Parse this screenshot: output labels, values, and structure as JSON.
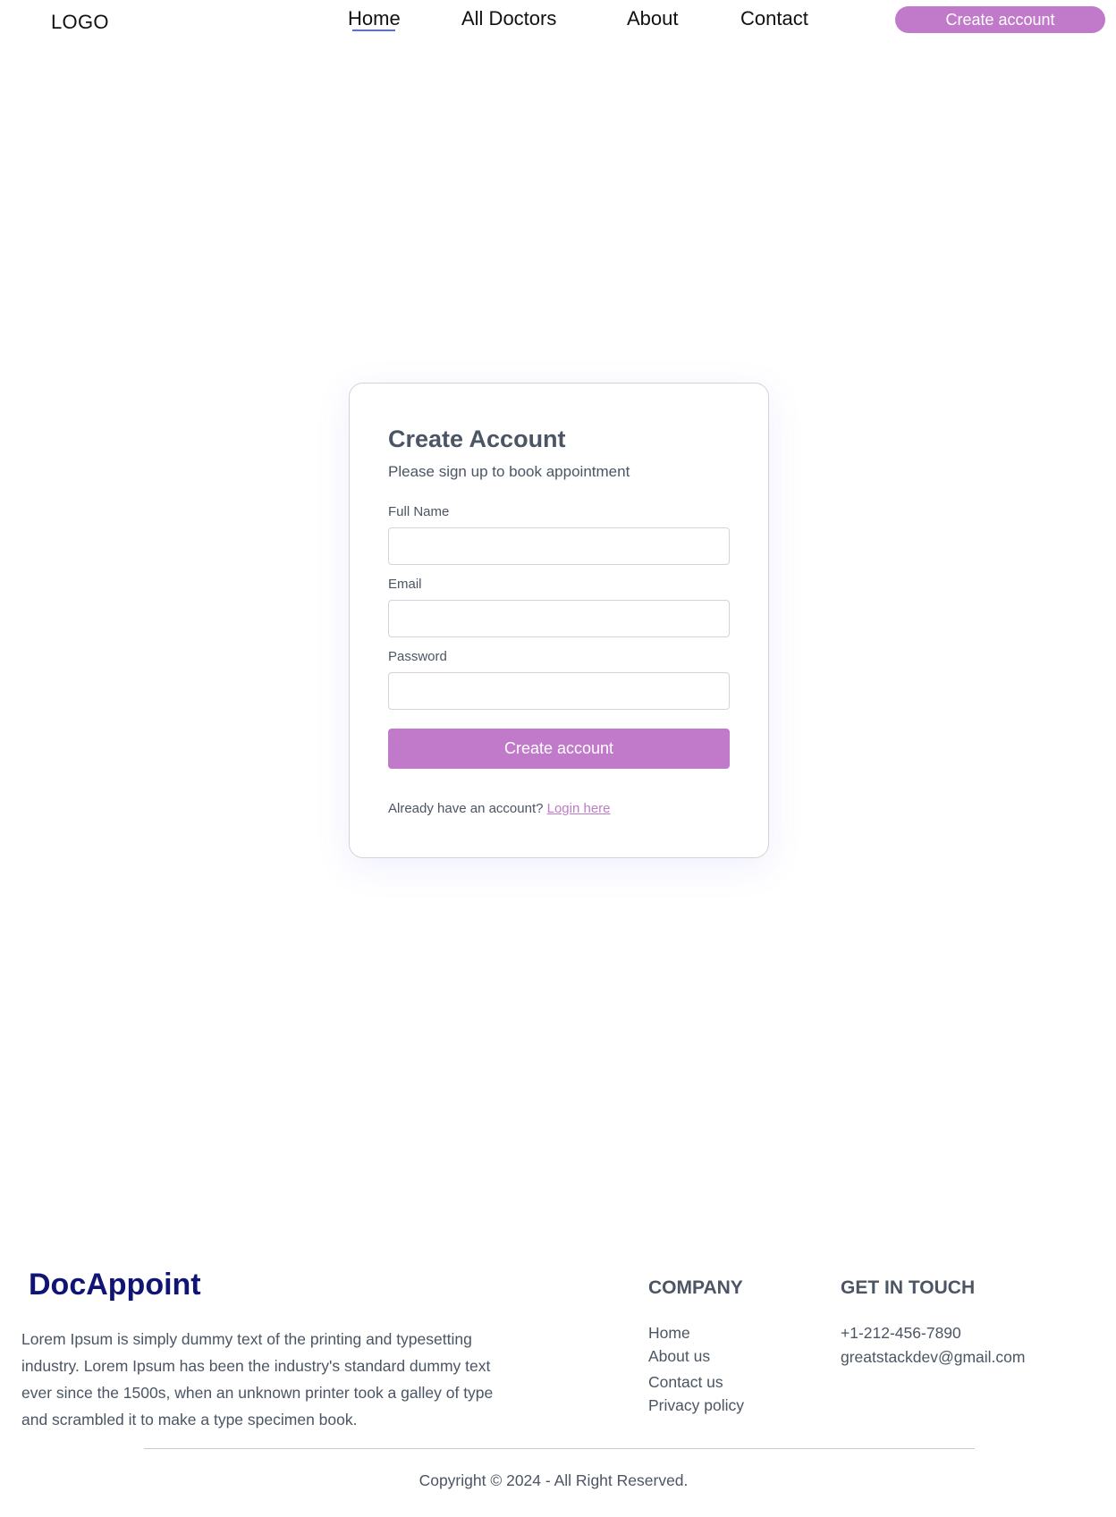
{
  "nav": {
    "logo": "LOGO",
    "links": [
      "Home",
      "All Doctors",
      "About",
      "Contact"
    ],
    "active": "Home",
    "cta_label": "Create account"
  },
  "form": {
    "title": "Create Account",
    "subtitle": "Please sign up to book appointment",
    "fields": [
      {
        "label": "Full Name",
        "value": ""
      },
      {
        "label": "Email",
        "value": ""
      },
      {
        "label": "Password",
        "value": ""
      }
    ],
    "submit_label": "Create account",
    "login_prompt": "Already have an account?",
    "login_link": "Login here"
  },
  "footer": {
    "brand": "DocAppoint",
    "about": "Lorem Ipsum is simply dummy text of the printing and typesetting industry. Lorem Ipsum has been the industry's standard dummy text ever since the 1500s, when an unknown printer took a galley of type and scrambled it to make a type specimen book.",
    "company_heading": "COMPANY",
    "company_links": [
      "Home",
      "About us",
      "Contact us",
      "Privacy policy"
    ],
    "touch_heading": "GET IN TOUCH",
    "phone": "+1-212-456-7890",
    "email": "greatstackdev@gmail.com",
    "copyright": "Copyright © 2024 - All Right Reserved."
  },
  "colors": {
    "accent": "#c07ac9",
    "brand": "#0f1475",
    "active_underline": "#5b6cf0",
    "text": "#4b5563"
  }
}
